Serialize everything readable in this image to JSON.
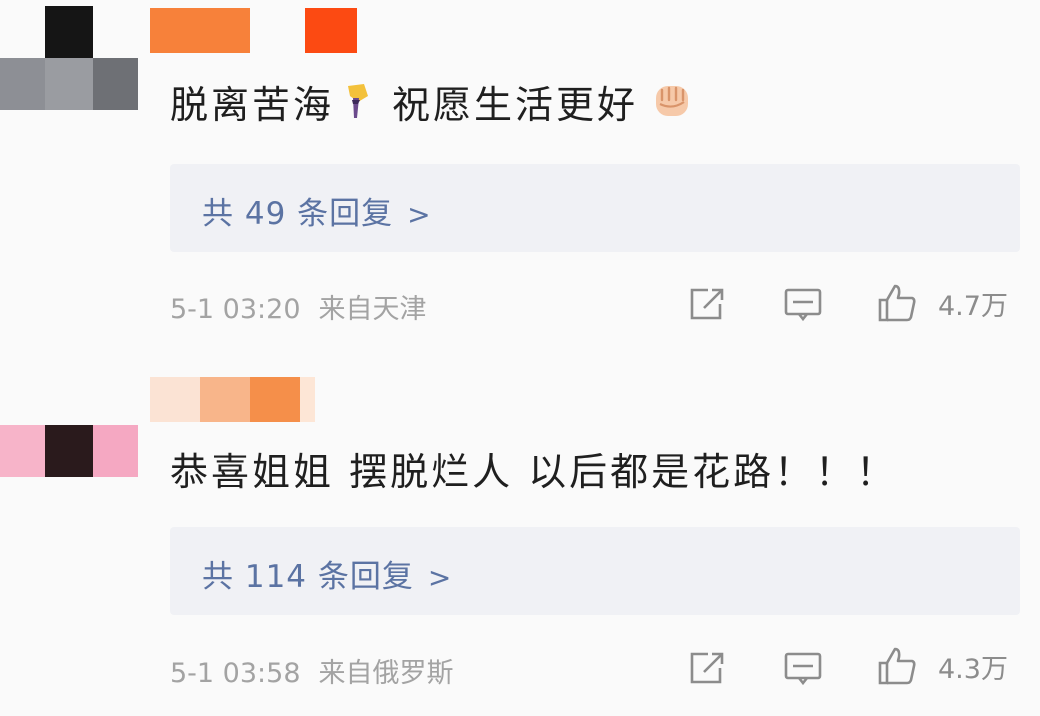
{
  "comments": [
    {
      "text": "脱离苦海",
      "text_emoji": "torch-icon",
      "text_2": "祝愿生活更好",
      "trailing_emoji": "raised-fist-icon",
      "reply_summary": "共 49 条回复",
      "reply_chevron": ">",
      "time": "5-1 03:20",
      "location": "来自天津",
      "likes": "4.7万"
    },
    {
      "text": "恭喜姐姐 摆脱烂人 以后都是花路！！！",
      "reply_summary": "共 114 条回复",
      "reply_chevron": ">",
      "time": "5-1 03:58",
      "location": "来自俄罗斯",
      "likes": "4.3万"
    }
  ],
  "icons": {
    "share": "share-icon",
    "comment": "comment-icon",
    "like": "thumbs-up-icon"
  },
  "colors": {
    "link": "#5b73a3",
    "meta": "#a3a3a3",
    "reply_bg": "#f0f1f5",
    "background": "#fafafa"
  }
}
